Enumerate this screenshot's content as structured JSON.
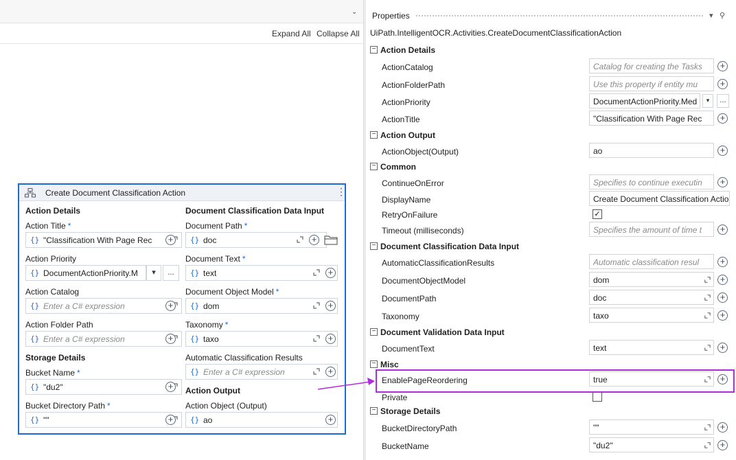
{
  "designer": {
    "expand_all": "Expand All",
    "collapse_all": "Collapse All"
  },
  "activity": {
    "title": "Create Document Classification Action",
    "left": {
      "section_action_details": "Action Details",
      "action_title": {
        "label": "Action Title",
        "required": "*",
        "value": "\"Classification With Page Rec"
      },
      "action_priority": {
        "label": "Action Priority",
        "value": "DocumentActionPriority.M",
        "ellipsis": "..."
      },
      "action_catalog": {
        "label": "Action Catalog",
        "placeholder": "Enter a C# expression"
      },
      "action_folder_path": {
        "label": "Action Folder Path",
        "placeholder": "Enter a C# expression"
      },
      "section_storage": "Storage Details",
      "bucket_name": {
        "label": "Bucket Name",
        "required": "*",
        "value": "\"du2\""
      },
      "bucket_dir": {
        "label": "Bucket Directory Path",
        "required": "*",
        "value": "\"\""
      }
    },
    "right": {
      "section_input": "Document Classification Data Input",
      "document_path": {
        "label": "Document Path",
        "required": "*",
        "value": "doc"
      },
      "document_text": {
        "label": "Document Text",
        "required": "*",
        "value": "text"
      },
      "document_object_model": {
        "label": "Document Object Model",
        "required": "*",
        "value": "dom"
      },
      "taxonomy": {
        "label": "Taxonomy",
        "required": "*",
        "value": "taxo"
      },
      "auto_results": {
        "label": "Automatic Classification Results",
        "placeholder": "Enter a C# expression"
      },
      "section_output": "Action Output",
      "action_object": {
        "label": "Action Object (Output)",
        "value": "ao"
      }
    }
  },
  "properties": {
    "title": "Properties",
    "type_name": "UiPath.IntelligentOCR.Activities.CreateDocumentClassificationAction",
    "categories": {
      "action_details": "Action Details",
      "action_output": "Action Output",
      "common": "Common",
      "doc_class_input": "Document Classification Data Input",
      "doc_valid_input": "Document Validation Data Input",
      "misc": "Misc",
      "storage": "Storage Details"
    },
    "rows": {
      "ActionCatalog": {
        "name": "ActionCatalog",
        "placeholder": "Catalog for creating the Tasks"
      },
      "ActionFolderPath": {
        "name": "ActionFolderPath",
        "placeholder": "Use this property if entity mu"
      },
      "ActionPriority": {
        "name": "ActionPriority",
        "value": "DocumentActionPriority.Med",
        "ellipsis": "..."
      },
      "ActionTitle": {
        "name": "ActionTitle",
        "value": "\"Classification With Page Rec"
      },
      "ActionObject": {
        "name": "ActionObject(Output)",
        "value": "ao"
      },
      "ContinueOnError": {
        "name": "ContinueOnError",
        "placeholder": "Specifies to continue executin"
      },
      "DisplayName": {
        "name": "DisplayName",
        "value": "Create Document Classification Action"
      },
      "RetryOnFailure": {
        "name": "RetryOnFailure",
        "checked": true
      },
      "Timeout": {
        "name": "Timeout (milliseconds)",
        "placeholder": "Specifies the amount of time t"
      },
      "AutomaticClassificationResults": {
        "name": "AutomaticClassificationResults",
        "placeholder": "Automatic classification resul"
      },
      "DocumentObjectModel": {
        "name": "DocumentObjectModel",
        "value": "dom"
      },
      "DocumentPath": {
        "name": "DocumentPath",
        "value": "doc"
      },
      "Taxonomy": {
        "name": "Taxonomy",
        "value": "taxo"
      },
      "DocumentText": {
        "name": "DocumentText",
        "value": "text"
      },
      "EnablePageReordering": {
        "name": "EnablePageReordering",
        "value": "true"
      },
      "Private": {
        "name": "Private",
        "checked": false
      },
      "BucketDirectoryPath": {
        "name": "BucketDirectoryPath",
        "value": "\"\""
      },
      "BucketName": {
        "name": "BucketName",
        "value": "\"du2\""
      }
    }
  },
  "colors": {
    "activity_border": "#1e6ad4",
    "highlight": "#b12bdb",
    "required_asterisk": "#1e6ad4"
  },
  "icons": [
    "sequence-activity-icon",
    "more-vertical-icon",
    "expand-editor-icon",
    "add-variable-icon",
    "folder-icon",
    "dropdown-chevron-icon",
    "pin-icon",
    "collapse-icon",
    "arrow-annotation"
  ]
}
